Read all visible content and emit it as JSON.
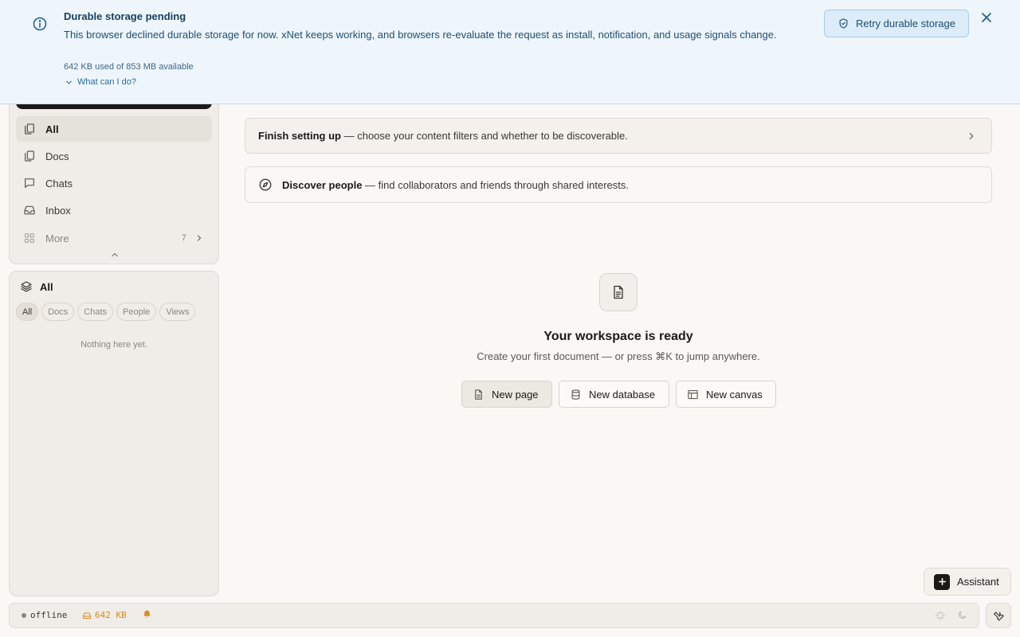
{
  "banner": {
    "title": "Durable storage pending",
    "message": "This browser declined durable storage for now. xNet keeps working, and browsers re-evaluate the request as install, notification, and usage signals change.",
    "usage": "642 KB used of 853 MB available",
    "help_link": "What can I do?",
    "retry_label": "Retry durable storage",
    "icon": "info-icon",
    "color": "#eef6fc"
  },
  "sidebar": {
    "nav": [
      {
        "label": "All",
        "icon": "pages-icon",
        "active": true
      },
      {
        "label": "Docs",
        "icon": "docs-icon"
      },
      {
        "label": "Chats",
        "icon": "chat-icon"
      },
      {
        "label": "Inbox",
        "icon": "inbox-icon"
      },
      {
        "label": "More",
        "icon": "grid-icon",
        "count": "7"
      }
    ],
    "list": {
      "title": "All",
      "filters": [
        "All",
        "Docs",
        "Chats",
        "People",
        "Views"
      ],
      "empty_text": "Nothing here yet."
    }
  },
  "main": {
    "setup_prompt": {
      "title": "Finish setting up",
      "text": " — choose your content filters and whether to be discoverable."
    },
    "discover_prompt": {
      "title": "Discover people",
      "text": " — find collaborators and friends through shared interests."
    },
    "empty_state": {
      "title": "Your workspace is ready",
      "subtitle": "Create your first document — or press ⌘K to jump anywhere.",
      "actions": [
        "New page",
        "New database",
        "New canvas"
      ]
    },
    "assistant_label": "Assistant"
  },
  "status_bar": {
    "connection": "offline",
    "storage": "642 KB",
    "accent": "#d68b1a"
  }
}
